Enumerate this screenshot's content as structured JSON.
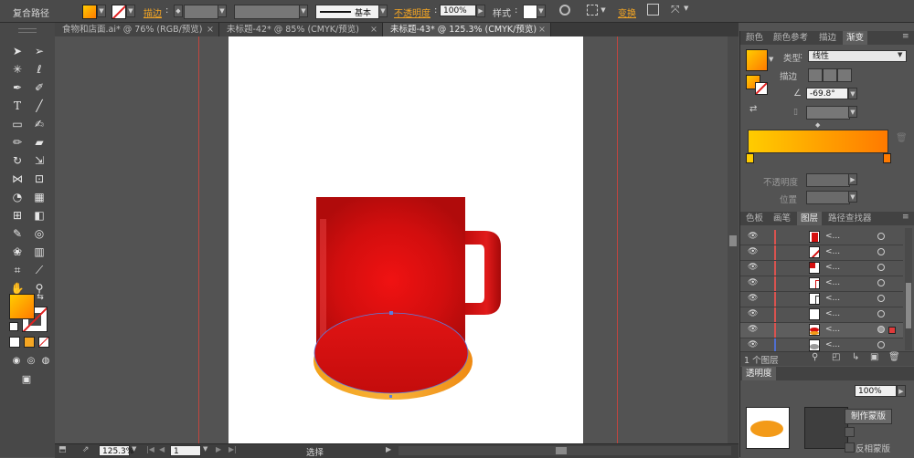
{
  "control_bar": {
    "selection_type": "复合路径",
    "stroke_label": "描边",
    "brush_label": "基本",
    "opacity_label": "不透明度",
    "opacity_value": "100%",
    "style_label": "样式",
    "transform_label": "变换"
  },
  "tabs": [
    {
      "label": "食物和店面.ai* @ 76% (RGB/预览)"
    },
    {
      "label": "未标题-42* @ 85% (CMYK/预览)"
    },
    {
      "label": "未标题-43* @ 125.3% (CMYK/预览)"
    }
  ],
  "status_bar": {
    "zoom": "125.3%",
    "artboard": "1",
    "mode": "选择"
  },
  "gradient_panel": {
    "tabs": [
      "颜色",
      "颜色参考",
      "描边",
      "渐变"
    ],
    "type_label": "类型",
    "type_value": "线性",
    "stroke_label": "描边",
    "angle_value": "-69.8°",
    "opacity_label": "不透明度",
    "position_label": "位置"
  },
  "layers_panel": {
    "tabs": [
      "色板",
      "画笔",
      "图层",
      "路径查找器"
    ],
    "rows": [
      {
        "name": "<..."
      },
      {
        "name": "<..."
      },
      {
        "name": "<..."
      },
      {
        "name": "<..."
      },
      {
        "name": "<..."
      },
      {
        "name": "<..."
      },
      {
        "name": "<..."
      },
      {
        "name": "<..."
      }
    ],
    "footer": "1 个图层"
  },
  "transparency_panel": {
    "title": "透明度",
    "opacity_value": "100%",
    "make_mask_button": "制作蒙版",
    "invert_mask_label": "反相蒙版"
  },
  "colors": {
    "mug_red": "#d50f0f",
    "base_orange": "#f39a18",
    "gradient_start": "#ffcc00",
    "gradient_end": "#ff7a00",
    "guide": "#c0453f"
  }
}
